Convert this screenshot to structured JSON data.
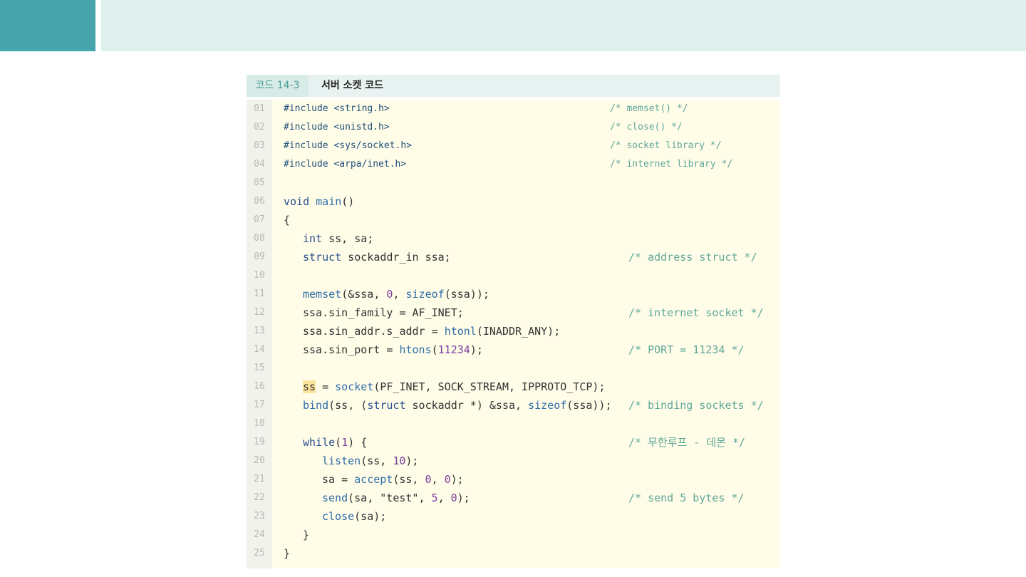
{
  "code_block": {
    "label": "코드 14-3",
    "title": "서버 소켓 코드"
  },
  "lines": [
    {
      "n": "01",
      "code": "#include <string.h>",
      "comment": "/* memset() */"
    },
    {
      "n": "02",
      "code": "#include <unistd.h>",
      "comment": "/* close() */"
    },
    {
      "n": "03",
      "code": "#include <sys/socket.h>",
      "comment": "/* socket library */"
    },
    {
      "n": "04",
      "code": "#include <arpa/inet.h>",
      "comment": "/* internet library */"
    },
    {
      "n": "05",
      "code": "",
      "comment": ""
    },
    {
      "n": "06",
      "code": "void main()",
      "comment": ""
    },
    {
      "n": "07",
      "code": "{",
      "comment": ""
    },
    {
      "n": "08",
      "code": "int ss, sa;",
      "comment": ""
    },
    {
      "n": "09",
      "code": "struct sockaddr_in ssa;",
      "comment": "/* address struct */"
    },
    {
      "n": "10",
      "code": "",
      "comment": ""
    },
    {
      "n": "11",
      "code": "memset(&ssa, 0, sizeof(ssa));",
      "comment": ""
    },
    {
      "n": "12",
      "code": "ssa.sin_family = AF_INET;",
      "comment": "/* internet socket */"
    },
    {
      "n": "13",
      "code": "ssa.sin_addr.s_addr = htonl(INADDR_ANY);",
      "comment": ""
    },
    {
      "n": "14",
      "code": "ssa.sin_port = htons(11234);",
      "comment": "/* PORT = 11234 */"
    },
    {
      "n": "15",
      "code": "",
      "comment": ""
    },
    {
      "n": "16",
      "code": "ss = socket(PF_INET, SOCK_STREAM, IPPROTO_TCP);",
      "comment": ""
    },
    {
      "n": "17",
      "code": "bind(ss, (struct sockaddr *) &ssa, sizeof(ssa));",
      "comment": "/* binding sockets */"
    },
    {
      "n": "18",
      "code": "",
      "comment": ""
    },
    {
      "n": "19",
      "code": "while(1) {",
      "comment": "/* 무한루프 - 데몬 */"
    },
    {
      "n": "20",
      "code": "listen(ss, 10);",
      "comment": ""
    },
    {
      "n": "21",
      "code": "sa = accept(ss, 0, 0);",
      "comment": ""
    },
    {
      "n": "22",
      "code": "send(sa, \"test\", 5, 0);",
      "comment": "/* send 5 bytes */"
    },
    {
      "n": "23",
      "code": "close(sa);",
      "comment": ""
    },
    {
      "n": "24",
      "code": "}",
      "comment": ""
    },
    {
      "n": "25",
      "code": "}",
      "comment": ""
    }
  ],
  "colors": {
    "accent": "#47a5ad",
    "band": "#dff0ee",
    "code_bg": "#fffce8",
    "comment": "#5fa89a",
    "highlight": "#fbe39a"
  }
}
